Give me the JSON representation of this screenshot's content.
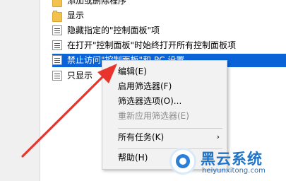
{
  "list": {
    "items": [
      {
        "label": "添加或删除程序",
        "icon": "folder-icon"
      },
      {
        "label": "显示",
        "icon": "folder-icon"
      },
      {
        "label": "隐藏指定的\"控制面板\"项",
        "icon": "policy-setting-icon"
      },
      {
        "label": "在打开\"控制面板\"时始终打开所有控制面板项",
        "icon": "policy-setting-icon"
      },
      {
        "label": "禁止访问\"控制面板\"和 PC 设置",
        "icon": "policy-setting-icon",
        "selected": true
      },
      {
        "label": "只显示",
        "icon": "policy-setting-icon"
      }
    ]
  },
  "context_menu": {
    "items": [
      {
        "label": "编辑(E)",
        "enabled": true
      },
      {
        "label": "启用筛选器(F)",
        "enabled": true
      },
      {
        "label": "筛选器选项(O)...",
        "enabled": true
      },
      {
        "label": "重新应用筛选器(E)",
        "enabled": false
      },
      {
        "label": "所有任务(K)",
        "enabled": true,
        "submenu": true
      },
      {
        "label": "帮助(H)",
        "enabled": true
      }
    ]
  },
  "watermark": {
    "name": "黑云系统",
    "site": "heiyunxitong.com"
  },
  "colors": {
    "selection": "#0a64d8",
    "arrow": "#e8342c",
    "brand": "#1f73c9"
  }
}
